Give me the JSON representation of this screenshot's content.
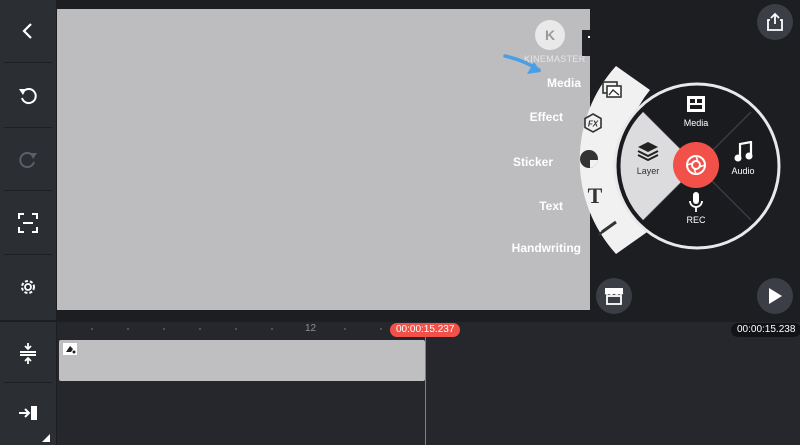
{
  "watermark": {
    "text": "KINEMASTER"
  },
  "media_menu": {
    "items": [
      {
        "label": "Media",
        "icon": "image-icon"
      },
      {
        "label": "Effect",
        "icon": "fx-icon"
      },
      {
        "label": "Sticker",
        "icon": "sticker-icon"
      },
      {
        "label": "Text",
        "icon": "text-icon"
      },
      {
        "label": "Handwriting",
        "icon": "brush-icon"
      }
    ]
  },
  "hub": {
    "media_label": "Media",
    "layer_label": "Layer",
    "audio_label": "Audio",
    "rec_label": "REC"
  },
  "timeline": {
    "ruler_mark": "12",
    "playhead_time": "00:00:15.237",
    "total_time": "00:00:15.238"
  },
  "colors": {
    "accent": "#f2514a",
    "hub_dark": "#1a1b1f",
    "preview": "#bdbcbf",
    "arrow": "#4a9ee8"
  }
}
